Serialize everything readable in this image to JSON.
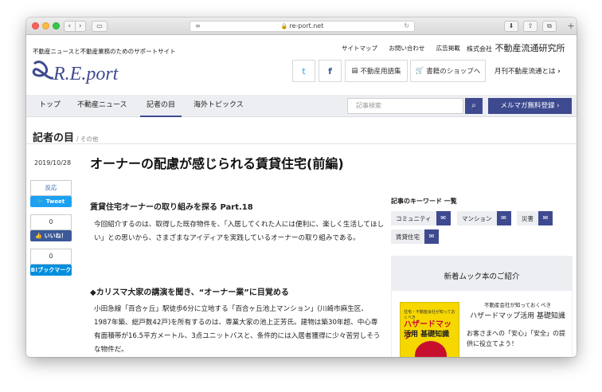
{
  "browser": {
    "url": "re-port.net",
    "back": "‹",
    "forward": "›",
    "plus": "+"
  },
  "header": {
    "tagline": "不動産ニュースと不動産業務のためのサポートサイト",
    "logo_text": "R.E.port",
    "top_links": [
      "サイトマップ",
      "お問い合わせ",
      "広告掲載"
    ],
    "company_prefix": "株式会社",
    "company_name": "不動産流通研究所",
    "twitter_icon": "t",
    "facebook_icon": "f",
    "glossary": "不動産用語集",
    "shop": "書籍のショップへ",
    "monthly": "月刊不動産流通とは"
  },
  "nav": {
    "items": [
      "トップ",
      "不動産ニュース",
      "記者の目",
      "海外トピックス"
    ],
    "search_placeholder": "記事検索",
    "register": "メルマガ無料登録"
  },
  "section": {
    "title": "記者の目",
    "breadcrumb": "/ その他"
  },
  "article": {
    "date": "2019/10/28",
    "title": "オーナーの配慮が感じられる賃貸住宅(前編)",
    "subtitle": "賃貸住宅オーナーの取り組みを探る Part.18",
    "para1": "今回紹介するのは、取得した既存物件を、「入居してくれた人には便利に、楽しく生活してほしい」との思いから、さまざまなアイディアを実践しているオーナーの取り組みである。",
    "heading2": "◆カリスマ大家の講演を聞き、“オーナー業”に目覚める",
    "para2": "小田急線「百合ヶ丘」駅徒歩6分に立地する「百合ヶ丘池上マンション」(川崎市麻生区、1987年築、総戸数42戸)を所有するのは、専業大家の池上正芳氏。建物は築30年超、中心専有面積帯が16.5平方メートル、3点ユニットバスと、条件的には入居者獲得に少々苦労しそうな物件だ。"
  },
  "social": {
    "retweet": "反応",
    "tweet": "Tweet",
    "like_count": "0",
    "like": "いいね！",
    "hatena_count": "0",
    "hatena": "B!ブックマーク"
  },
  "keywords": {
    "title": "記事のキーワード 一覧",
    "items": [
      "コミュニティ",
      "マンション",
      "災害",
      "賃貸住宅"
    ]
  },
  "mook": {
    "title": "新着ムック本のご紹介",
    "book_cover_top": "住宅・不動産会社が知っておくべき",
    "book_cover_title1": "ハザードマップ",
    "book_cover_title2": "活用 基礎知識",
    "book_small": "不動産会社が知っておくべき",
    "book_title": "ハザードマップ活用 基礎知識",
    "book_desc": "お客さまへの「安心」「安全」の提供に役立てよう！"
  },
  "colors": {
    "accent": "#3e4a8f",
    "nav_bg": "#eceef2",
    "twitter": "#1da1f2",
    "facebook": "#3b5998",
    "hatena": "#008fde"
  }
}
